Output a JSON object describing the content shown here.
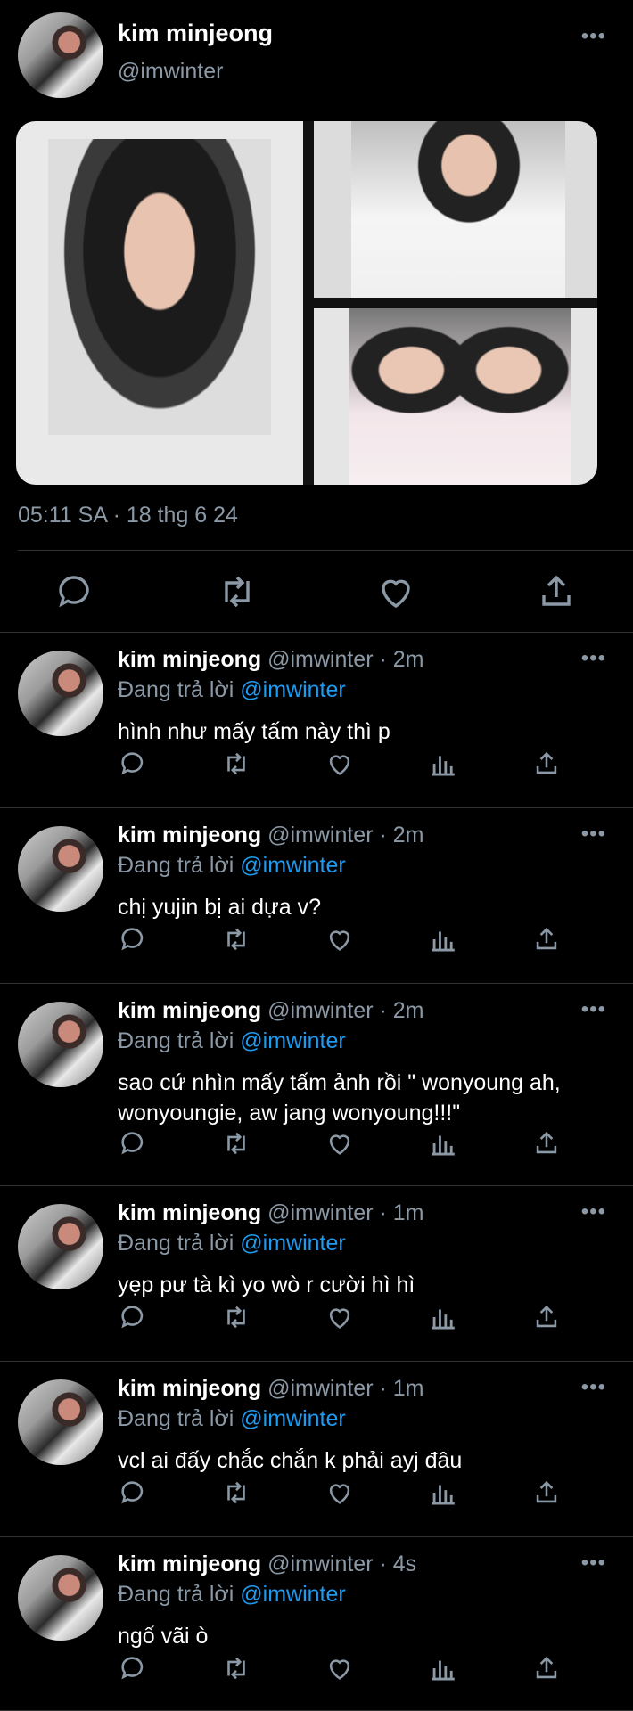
{
  "tweet": {
    "name": "kim minjeong",
    "handle": "@imwinter",
    "timestamp": "05:11 SA · 18 thg 6 24",
    "more_icon": "ellipsis-icon",
    "actions": [
      "reply-icon",
      "retweet-icon",
      "like-icon",
      "share-icon"
    ]
  },
  "replies": [
    {
      "name": "kim minjeong",
      "handle": "@imwinter · 2m",
      "replying": "Đang trả lời ",
      "mention": "@imwinter",
      "text": "hình như mấy tấm này thì p"
    },
    {
      "name": "kim minjeong",
      "handle": "@imwinter · 2m",
      "replying": "Đang trả lời ",
      "mention": "@imwinter",
      "text": "chị yujin bị ai dựa v?"
    },
    {
      "name": "kim minjeong",
      "handle": "@imwinter · 2m",
      "replying": "Đang trả lời ",
      "mention": "@imwinter",
      "text": "sao cứ nhìn mấy tấm ảnh rồi \" wonyoung ah, wonyoungie, aw jang wonyoung!!!\""
    },
    {
      "name": "kim minjeong",
      "handle": "@imwinter · 1m",
      "replying": "Đang trả lời ",
      "mention": "@imwinter",
      "text": "yẹp pư tà kì yo wò r cười hì hì"
    },
    {
      "name": "kim minjeong",
      "handle": "@imwinter · 1m",
      "replying": "Đang trả lời ",
      "mention": "@imwinter",
      "text": "vcl ai đấy chắc chắn k phải ayj đâu"
    },
    {
      "name": "kim minjeong",
      "handle": "@imwinter · 4s",
      "replying": "Đang trả lời ",
      "mention": "@imwinter",
      "text": "ngố vãi ò"
    }
  ],
  "colors": {
    "background": "#000000",
    "muted": "#8b98a5",
    "link": "#1d9bf0",
    "divider": "#2f3336"
  }
}
